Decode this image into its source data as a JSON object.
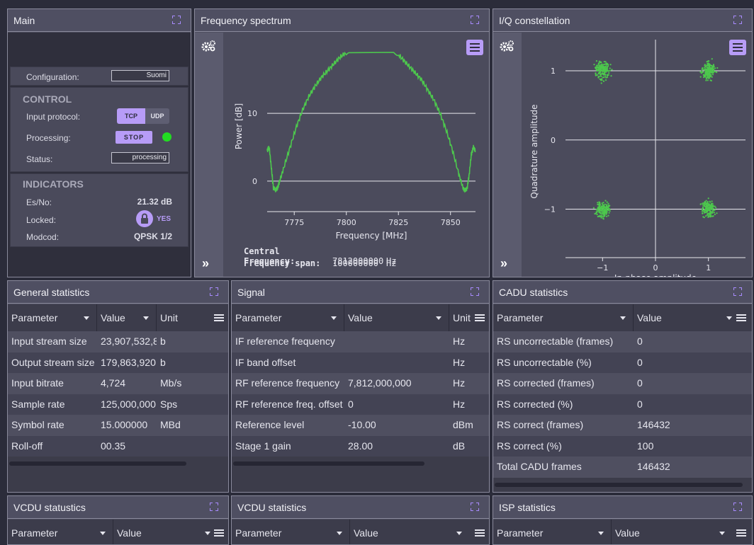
{
  "main": {
    "title": "Main",
    "configuration_label": "Configuration:",
    "configuration_value": "Suomi",
    "control_heading": "CONTROL",
    "input_protocol_label": "Input protocol:",
    "protocol_tcp": "TCP",
    "protocol_udp": "UDP",
    "processing_label": "Processing:",
    "stop_label": "STOP",
    "processing_indicator_color": "#22dd22",
    "status_label": "Status:",
    "status_value": "processing",
    "indicators_heading": "INDICATORS",
    "esno_label": "Es/No:",
    "esno_value": "21.32 dB",
    "locked_label": "Locked:",
    "locked_value": "YES",
    "modcod_label": "Modcod:",
    "modcod_value": "QPSK 1/2"
  },
  "spectrum": {
    "title": "Frequency spectrum",
    "central_freq_label": "Central Frequency:",
    "central_freq_value": "7812000000",
    "central_freq_unit": "Hz",
    "span_label": "Frequency span:",
    "span_value": "100000000",
    "span_unit": "Hz"
  },
  "iq": {
    "title": "I/Q constellation"
  },
  "chart_data": [
    {
      "type": "line",
      "xlabel": "Frequency [MHz]",
      "ylabel": "Power [dB]",
      "xticks": [
        7775,
        7800,
        7825,
        7850
      ],
      "yticks": [
        0,
        10
      ],
      "xlim": [
        7762,
        7862
      ],
      "ylim": [
        -4.5,
        19
      ],
      "series": [
        {
          "x": [
            7762,
            7763,
            7764,
            7765,
            7766,
            7767,
            7768,
            7770,
            7773,
            7776,
            7779,
            7782,
            7785,
            7788,
            7791,
            7794,
            7797,
            7800,
            7802,
            7803,
            7821,
            7822,
            7824,
            7827,
            7830,
            7833,
            7836,
            7839,
            7842,
            7845,
            7848,
            7851,
            7854,
            7856,
            7857,
            7858,
            7859,
            7860,
            7861,
            7862
          ],
          "y": [
            4.5,
            5,
            2,
            -1,
            -1.3,
            -1,
            0,
            2,
            5,
            8,
            10.5,
            12.5,
            14,
            15.3,
            16.3,
            17.3,
            18.3,
            19,
            19.3,
            19.5,
            19.5,
            19.3,
            19,
            18,
            17,
            16,
            15,
            13.5,
            12,
            10,
            7.5,
            4.5,
            1,
            -1,
            -1.4,
            -1,
            1,
            4,
            5,
            4.5
          ],
          "color": "#4dc84d"
        }
      ]
    },
    {
      "type": "scatter",
      "xlabel": "In-phase amplitude",
      "ylabel": "Quadrature amplitude",
      "xticks": [
        -1,
        0,
        1
      ],
      "yticks": [
        -1,
        0,
        1
      ],
      "xlim": [
        -1.7,
        1.7
      ],
      "ylim": [
        -1.7,
        1.45
      ],
      "series": [
        {
          "name": "",
          "color": "#4dc84d",
          "clusters": [
            [
              -1,
              1
            ],
            [
              1,
              1
            ],
            [
              -1,
              -1
            ],
            [
              1,
              -1
            ]
          ],
          "spread": 0.12
        }
      ]
    }
  ],
  "general_statistics": {
    "title": "General statistics",
    "columns": [
      "Parameter",
      "Value",
      "Unit"
    ],
    "rows": [
      [
        "Input stream size",
        "23,907,532,8",
        "b"
      ],
      [
        "Output stream size",
        "179,863,920",
        "b"
      ],
      [
        "Input bitrate",
        "4,724",
        "Mb/s"
      ],
      [
        "Sample rate",
        "125,000,000",
        "Sps"
      ],
      [
        "Symbol rate",
        "15.000000",
        "MBd"
      ],
      [
        "Roll-off",
        "00.35",
        ""
      ]
    ]
  },
  "signal": {
    "title": "Signal",
    "columns": [
      "Parameter",
      "Value",
      "Unit"
    ],
    "rows": [
      [
        "IF reference frequency",
        "",
        "Hz"
      ],
      [
        "IF band offset",
        "",
        "Hz"
      ],
      [
        "RF reference frequency",
        "7,812,000,000",
        "Hz"
      ],
      [
        "RF reference freq. offset",
        "0",
        "Hz"
      ],
      [
        "Reference level",
        "-10.00",
        "dBm"
      ],
      [
        "Stage 1 gain",
        "28.00",
        "dB"
      ]
    ]
  },
  "cadu_statistics": {
    "title": "CADU statistics",
    "columns": [
      "Parameter",
      "Value"
    ],
    "rows": [
      [
        "RS uncorrectable (frames)",
        "0"
      ],
      [
        "RS uncorrectable (%)",
        "0"
      ],
      [
        "RS corrected (frames)",
        "0"
      ],
      [
        "RS corrected (%)",
        "0"
      ],
      [
        "RS correct (frames)",
        "146432"
      ],
      [
        "RS correct (%)",
        "100"
      ],
      [
        "Total CADU frames",
        "146432"
      ]
    ]
  },
  "vcdu_statustics": {
    "title": "VCDU statustics",
    "columns": [
      "Parameter",
      "Value"
    ]
  },
  "vcdu_statistics": {
    "title": "VCDU statistics",
    "columns": [
      "Parameter",
      "Value"
    ]
  },
  "isp_statistics": {
    "title": "ISP statistics",
    "columns": [
      "Parameter",
      "Value"
    ]
  }
}
